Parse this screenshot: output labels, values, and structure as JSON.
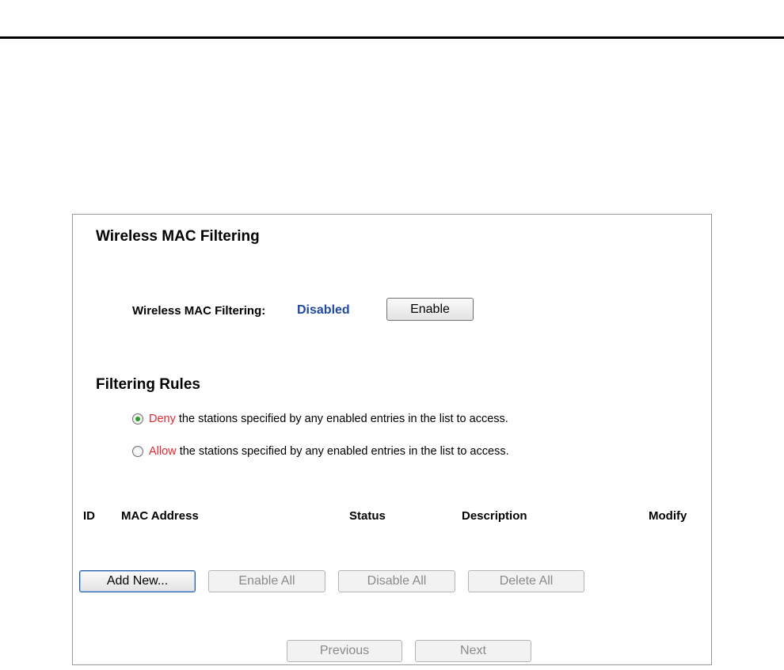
{
  "page": {
    "title": "Wireless MAC Filtering"
  },
  "filtering": {
    "label": "Wireless MAC Filtering:",
    "status": "Disabled",
    "enable_label": "Enable"
  },
  "rules": {
    "title": "Filtering Rules",
    "options": [
      {
        "keyword": "Deny",
        "text": "the stations specified by any enabled entries in the list to access.",
        "checked": true
      },
      {
        "keyword": "Allow",
        "text": "the stations specified by any enabled entries in the list to access.",
        "checked": false
      }
    ]
  },
  "table": {
    "columns": [
      "ID",
      "MAC Address",
      "Status",
      "Description",
      "Modify"
    ]
  },
  "actions": {
    "add_new": "Add New...",
    "enable_all": "Enable All",
    "disable_all": "Disable All",
    "delete_all": "Delete All"
  },
  "pagination": {
    "previous": "Previous",
    "next": "Next"
  },
  "colors": {
    "status_value": "#1f4aa0",
    "keyword_red": "#e0282e",
    "radio_selected": "#2c9a2c"
  }
}
